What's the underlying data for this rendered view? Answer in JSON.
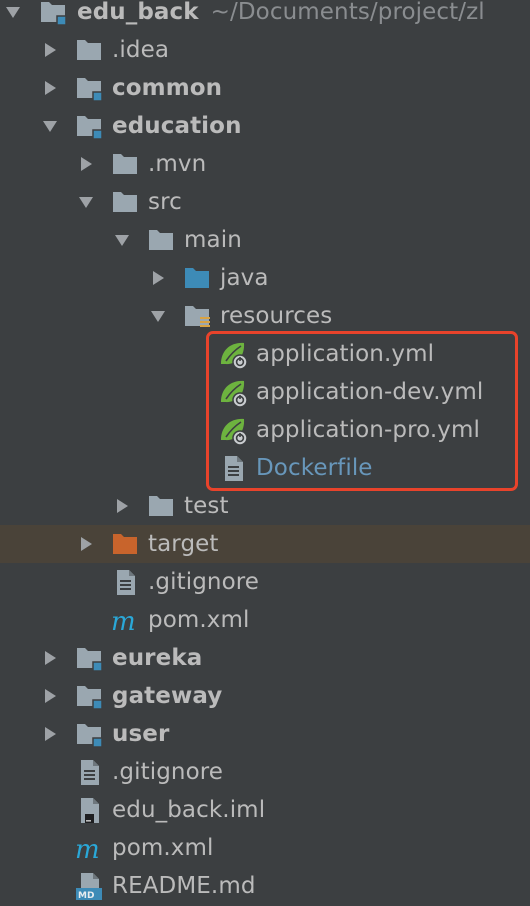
{
  "root": {
    "name": "edu_back",
    "path": "~/Documents/project/zl"
  },
  "tree": {
    "idea": ".idea",
    "common": "common",
    "education": "education",
    "mvn": ".mvn",
    "src": "src",
    "main": "main",
    "java": "java",
    "resources": "resources",
    "application_yml": "application.yml",
    "application_dev_yml": "application-dev.yml",
    "application_pro_yml": "application-pro.yml",
    "dockerfile": "Dockerfile",
    "test": "test",
    "target": "target",
    "edu_gitignore": ".gitignore",
    "edu_pom": "pom.xml",
    "eureka": "eureka",
    "gateway": "gateway",
    "user": "user",
    "root_gitignore": ".gitignore",
    "root_iml": "edu_back.iml",
    "root_pom": "pom.xml",
    "readme": "README.md"
  },
  "colors": {
    "background": "#3c3f41",
    "text": "#bbbbbb",
    "highlight_border": "#e8432b",
    "dockerfile_text": "#6897bb",
    "excluded_row": "#4a4339",
    "folder": "#9aa7b0",
    "source_folder": "#3d8bb7",
    "excluded_folder": "#c8642c",
    "spring_leaf": "#6db33f",
    "maven_m": "#2aa8d8"
  },
  "icons": {
    "expanded": "triangle-down-icon",
    "collapsed": "triangle-right-icon",
    "folder": "folder-icon",
    "module_folder": "module-folder-icon",
    "source_folder": "source-folder-icon",
    "resources_folder": "resources-folder-icon",
    "excluded_folder": "excluded-folder-icon",
    "spring_config": "spring-config-icon",
    "text_file": "text-file-icon",
    "maven": "maven-icon",
    "iml": "iml-file-icon",
    "markdown": "markdown-icon"
  }
}
